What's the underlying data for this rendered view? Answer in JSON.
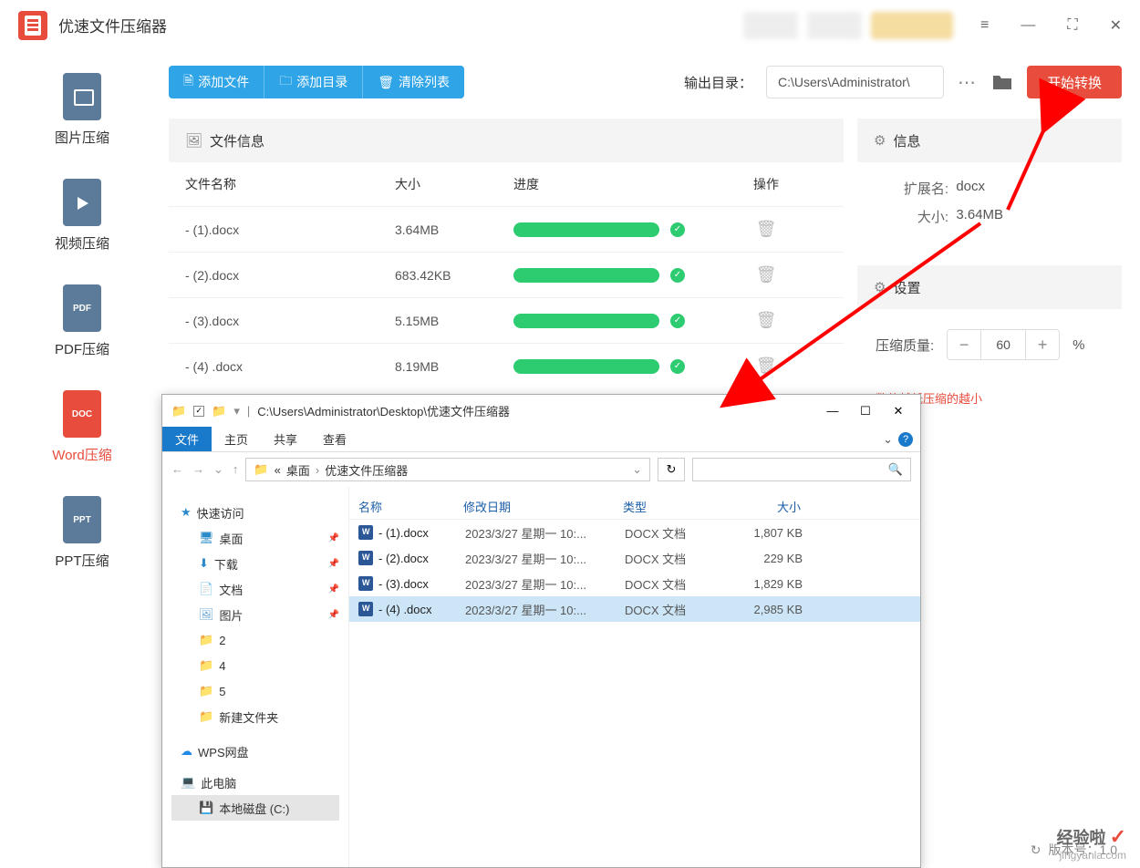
{
  "app": {
    "title": "优速文件压缩器"
  },
  "sidebar": {
    "items": [
      {
        "label": "图片压缩",
        "icon_text": ""
      },
      {
        "label": "视频压缩",
        "icon_text": ""
      },
      {
        "label": "PDF压缩",
        "icon_text": "PDF"
      },
      {
        "label": "Word压缩",
        "icon_text": "DOC"
      },
      {
        "label": "PPT压缩",
        "icon_text": "PPT"
      }
    ]
  },
  "toolbar": {
    "add_file": "添加文件",
    "add_dir": "添加目录",
    "clear_list": "清除列表",
    "output_label": "输出目录：",
    "output_path": "C:\\Users\\Administrator\\",
    "start": "开始转换"
  },
  "file_panel": {
    "title": "文件信息",
    "headers": {
      "name": "文件名称",
      "size": "大小",
      "progress": "进度",
      "action": "操作"
    },
    "rows": [
      {
        "name": "- (1).docx",
        "size": "3.64MB"
      },
      {
        "name": "- (2).docx",
        "size": "683.42KB"
      },
      {
        "name": "- (3).docx",
        "size": "5.15MB"
      },
      {
        "name": "- (4) .docx",
        "size": "8.19MB"
      }
    ]
  },
  "info_panel": {
    "title": "信息",
    "ext_label": "扩展名:",
    "ext_value": "docx",
    "size_label": "大小:",
    "size_value": "3.64MB"
  },
  "settings_panel": {
    "title": "设置",
    "quality_label": "压缩质量:",
    "quality_value": "60",
    "percent": "%",
    "hint": "数值越低压缩的越小"
  },
  "explorer": {
    "title_path": "C:\\Users\\Administrator\\Desktop\\优速文件压缩器",
    "tabs": {
      "file": "文件",
      "home": "主页",
      "share": "共享",
      "view": "查看"
    },
    "breadcrumb": {
      "sep1": "«",
      "p1": "桌面",
      "p2": "优速文件压缩器"
    },
    "nav": {
      "quick": "快速访问",
      "desktop": "桌面",
      "download": "下载",
      "docs": "文档",
      "pics": "图片",
      "f2": "2",
      "f4": "4",
      "f5": "5",
      "fnew": "新建文件夹",
      "wps": "WPS网盘",
      "thispc": "此电脑",
      "cdrive": "本地磁盘 (C:)"
    },
    "headers": {
      "name": "名称",
      "date": "修改日期",
      "type": "类型",
      "size": "大小"
    },
    "rows": [
      {
        "name": "- (1).docx",
        "date": "2023/3/27 星期一 10:...",
        "type": "DOCX 文档",
        "size": "1,807 KB"
      },
      {
        "name": "- (2).docx",
        "date": "2023/3/27 星期一 10:...",
        "type": "DOCX 文档",
        "size": "229 KB"
      },
      {
        "name": "- (3).docx",
        "date": "2023/3/27 星期一 10:...",
        "type": "DOCX 文档",
        "size": "1,829 KB"
      },
      {
        "name": "- (4) .docx",
        "date": "2023/3/27 星期一 10:...",
        "type": "DOCX 文档",
        "size": "2,985 KB"
      }
    ]
  },
  "footer": {
    "version": "版本号：1.0"
  },
  "watermark": {
    "top": "经验啦",
    "bottom": "jingyanla.com"
  }
}
